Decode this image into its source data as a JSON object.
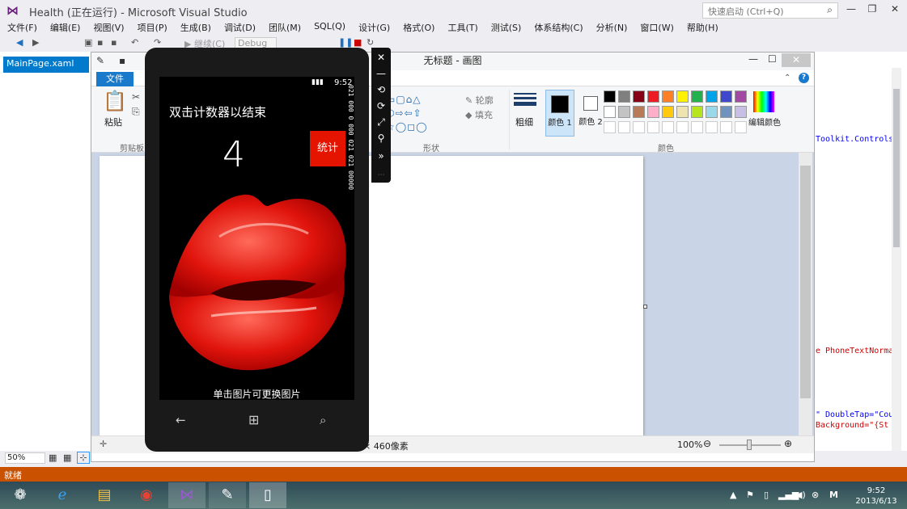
{
  "vs": {
    "title": "Health (正在运行) - Microsoft Visual Studio",
    "quick_launch_placeholder": "快速启动 (Ctrl+Q)",
    "menu": [
      "文件(F)",
      "编辑(E)",
      "视图(V)",
      "项目(P)",
      "生成(B)",
      "调试(D)",
      "团队(M)",
      "SQL(Q)",
      "设计(G)",
      "格式(O)",
      "工具(T)",
      "测试(S)",
      "体系结构(C)",
      "分析(N)",
      "窗口(W)",
      "帮助(H)"
    ],
    "toolbar": {
      "continue_label": "继续(C)",
      "config": "Debug"
    },
    "doc_tab": "MainPage.xaml",
    "code_lines": [
      "Toolkit.Controls\"",
      "e PhoneTextNormal",
      "\" DoubleTap=\"Cour",
      " Background=\"{St"
    ],
    "zoom": "50%",
    "status": "就绪"
  },
  "paint": {
    "title": "无标题 - 画图",
    "tab_file": "文件",
    "paste_label": "粘贴",
    "clipboard_label": "剪贴板",
    "shapes_label": "形状",
    "outline_label": "轮廓",
    "fill_label": "填充",
    "thickness_label": "粗细",
    "color1_label": "颜色 1",
    "color2_label": "颜色 2",
    "colors_label": "颜色",
    "edit_colors_label": "编辑颜色",
    "size_readout": "460像素",
    "zoom_level": "100%",
    "palette_row1": [
      "#000000",
      "#7f7f7f",
      "#880015",
      "#ed1c24",
      "#ff7f27",
      "#fff200",
      "#22b14c",
      "#00a2e8",
      "#3f48cc",
      "#a349a4"
    ],
    "palette_row2": [
      "#ffffff",
      "#c3c3c3",
      "#b97a57",
      "#ffaec9",
      "#ffc90e",
      "#efe4b0",
      "#b5e61d",
      "#99d9ea",
      "#7092be",
      "#c8bfe7"
    ]
  },
  "phone": {
    "time": "9:52",
    "app_title": "双击计数器以结束",
    "count": "4",
    "count_button": "统计",
    "hint": "单击图片可更换图片",
    "debug_counters": "021 000 0 000 021 021 00000"
  },
  "taskbar": {
    "time": "9:52",
    "date": "2013/6/13"
  }
}
